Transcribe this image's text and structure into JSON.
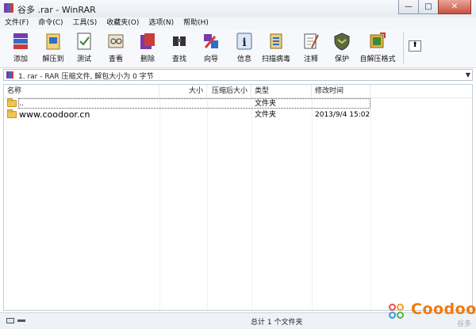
{
  "window": {
    "title": "谷多 .rar - WinRAR",
    "controls": {
      "minimize": "—",
      "maximize": "□",
      "close": "✕"
    }
  },
  "menu": [
    "文件(F)",
    "命令(C)",
    "工具(S)",
    "收藏夹(O)",
    "选项(N)",
    "帮助(H)"
  ],
  "toolbar": [
    {
      "label": "添加",
      "icon": "add-icon"
    },
    {
      "label": "解压到",
      "icon": "extract-icon"
    },
    {
      "label": "测试",
      "icon": "test-icon"
    },
    {
      "label": "查看",
      "icon": "view-icon"
    },
    {
      "label": "删除",
      "icon": "delete-icon"
    },
    {
      "label": "查找",
      "icon": "find-icon"
    },
    {
      "label": "向导",
      "icon": "wizard-icon"
    },
    {
      "label": "信息",
      "icon": "info-icon"
    },
    {
      "label": "扫描病毒",
      "icon": "virus-scan-icon"
    },
    {
      "label": "注释",
      "icon": "comment-icon"
    },
    {
      "label": "保护",
      "icon": "protect-icon"
    },
    {
      "label": "自解压格式",
      "icon": "sfx-icon"
    }
  ],
  "up_button": "⬆",
  "address": {
    "text": "1. rar - RAR 压缩文件, 解包大小为 0 字节",
    "dropdown": "▼"
  },
  "columns": [
    "名称",
    "大小",
    "压缩后大小",
    "类型",
    "修改时间"
  ],
  "rows": [
    {
      "name": "..",
      "size": "",
      "packed": "",
      "type": "文件夹",
      "modified": ""
    },
    {
      "name": "www.coodoor.cn",
      "size": "",
      "packed": "",
      "type": "文件夹",
      "modified": "2013/9/4 15:02"
    }
  ],
  "status": {
    "text": "总计 1 个文件夹"
  },
  "watermark": {
    "brand": "Coodoor",
    "sub": "谷多"
  },
  "colors": {
    "accent": "#ee7a12",
    "folder": "#f0c64d"
  }
}
